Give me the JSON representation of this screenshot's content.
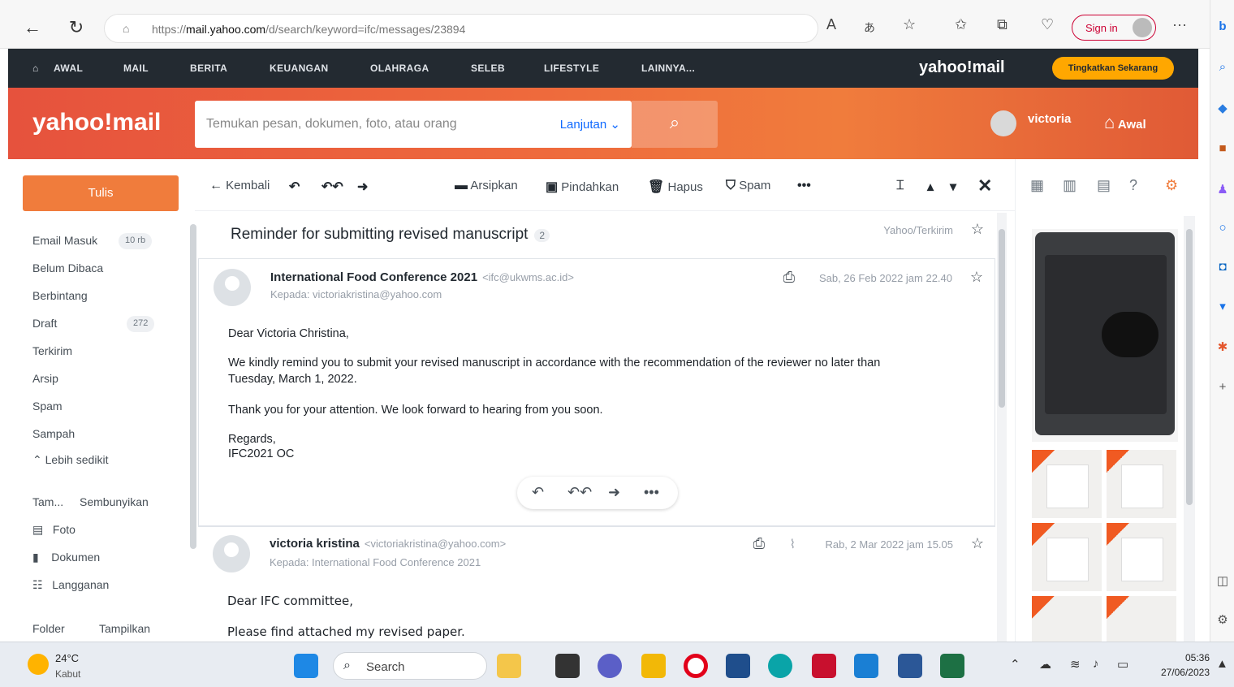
{
  "browser": {
    "url_prefix": "https://",
    "url_host": "mail.yahoo.com",
    "url_path": "/d/search/keyword=ifc/messages/23894",
    "sign_in": "Sign in"
  },
  "topnav": {
    "items": [
      "AWAL",
      "MAIL",
      "BERITA",
      "KEUANGAN",
      "OLAHRAGA",
      "SELEB",
      "LIFESTYLE",
      "LAINNYA..."
    ],
    "brand": "yahoo!mail",
    "upgrade": "Tingkatkan Sekarang"
  },
  "header": {
    "logo": "yahoo!mail",
    "search_placeholder": "Temukan pesan, dokumen, foto, atau orang",
    "advanced": "Lanjutan",
    "user": "victoria",
    "home": "Awal"
  },
  "sidebar": {
    "compose": "Tulis",
    "folders": [
      {
        "label": "Email Masuk",
        "badge": "10 rb"
      },
      {
        "label": "Belum Dibaca",
        "badge": ""
      },
      {
        "label": "Berbintang",
        "badge": ""
      },
      {
        "label": "Draft",
        "badge": "272"
      },
      {
        "label": "Terkirim",
        "badge": ""
      },
      {
        "label": "Arsip",
        "badge": ""
      },
      {
        "label": "Spam",
        "badge": ""
      },
      {
        "label": "Sampah",
        "badge": ""
      }
    ],
    "less": "Lebih sedikit",
    "views_label": "Tam...",
    "hide": "Sembunyikan",
    "views": [
      "Foto",
      "Dokumen",
      "Langganan"
    ],
    "folder_label": "Folder",
    "show": "Tampilkan"
  },
  "toolbar": {
    "back": "Kembali",
    "archive": "Arsipkan",
    "move": "Pindahkan",
    "delete": "Hapus",
    "spam": "Spam"
  },
  "thread": {
    "subject": "Reminder for submitting revised manuscript",
    "count": "2",
    "folders": "Yahoo/Terkirim",
    "messages": [
      {
        "from": "International Food Conference 2021",
        "address": "<ifc@ukwms.ac.id>",
        "to": "Kepada: victoriakristina@yahoo.com",
        "date": "Sab, 26 Feb 2022 jam 22.40",
        "body": [
          "Dear Victoria Christina,",
          "We kindly remind you to submit your revised manuscript in accordance with the recommendation of the reviewer no later than",
          "Tuesday, March 1, 2022.",
          "Thank you for your attention. We look forward to hearing from you soon.",
          "Regards,",
          "IFC2021 OC"
        ]
      },
      {
        "from": "victoria kristina",
        "address": "<victoriakristina@yahoo.com>",
        "to": "Kepada: International Food Conference 2021",
        "date": "Rab, 2 Mar 2022 jam 15.05",
        "body": [
          "Dear IFC committee,",
          "Please find attached my revised paper."
        ]
      }
    ]
  },
  "taskbar": {
    "temp": "24°C",
    "condition": "Kabut",
    "search": "Search",
    "time": "05:36",
    "date": "27/06/2023"
  },
  "colors": {
    "accent": "#f07c3c",
    "nav": "#232a31",
    "link": "#0f69ff",
    "upgrade": "#ffa700"
  }
}
